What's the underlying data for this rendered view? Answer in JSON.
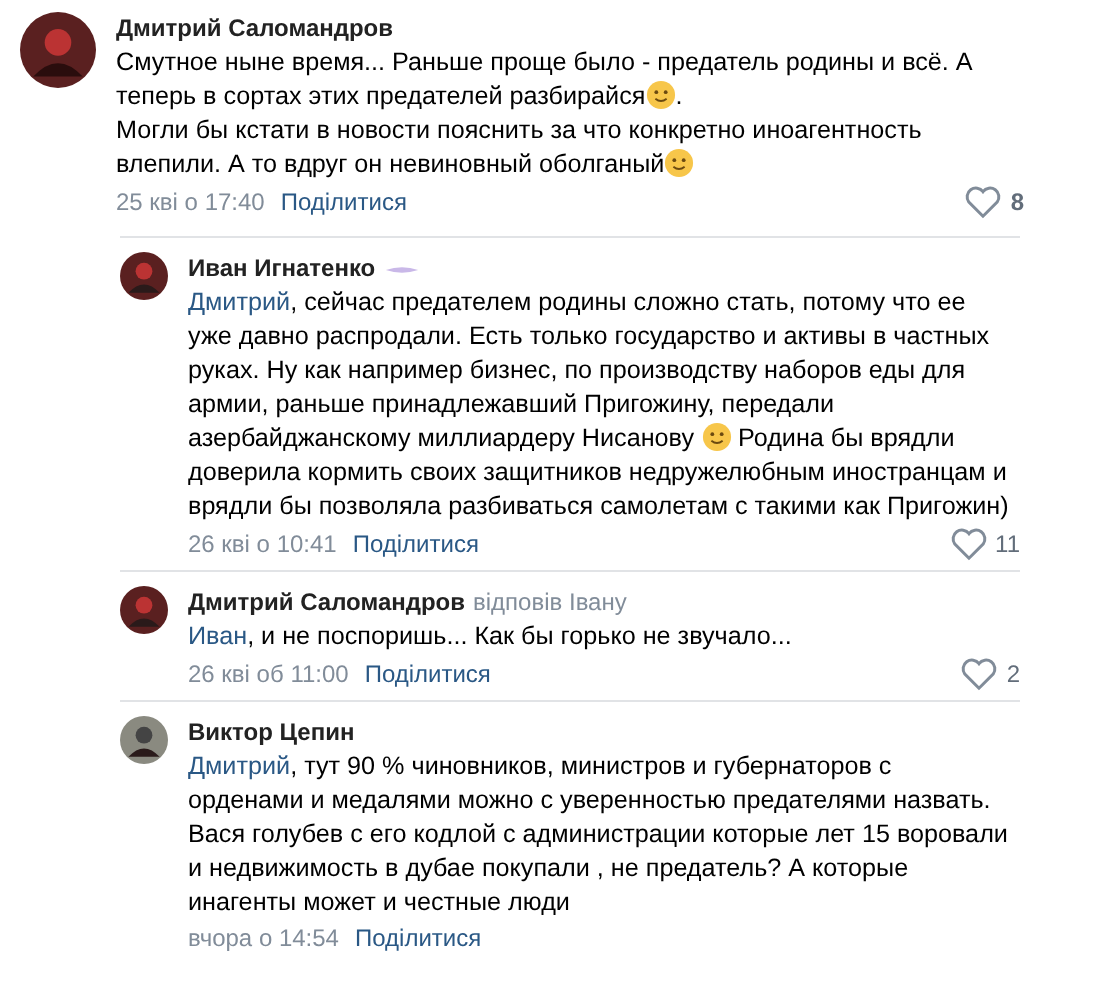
{
  "comments": [
    {
      "author": "Дмитрий Саломандров",
      "body": [
        {
          "kind": "text",
          "text": "Смутное ныне время... Раньше проще было - предатель родины и всё. А теперь в сортах этих предателей разбирайся"
        },
        {
          "kind": "emoji"
        },
        {
          "kind": "text",
          "text": ".\nМогли бы кстати в новости пояснить за что конкретно иноагентность влепили. А то вдруг он невиновный оболганый"
        },
        {
          "kind": "emoji"
        }
      ],
      "date": "25 кві о 17:40",
      "share": "Поділитися",
      "likes": "8",
      "liked_bold": true,
      "children": [
        {
          "author": "Иван Игнатенко",
          "badge": true,
          "body": [
            {
              "kind": "mention",
              "text": "Дмитрий"
            },
            {
              "kind": "text",
              "text": ", сейчас предателем родины сложно стать, потому что ее уже давно распродали. Есть только государство и активы в частных руках. Ну как например бизнес, по производству наборов еды для армии, раньше принадлежавший Пригожину, передали азербайджанскому миллиардеру Нисанову "
            },
            {
              "kind": "emoji"
            },
            {
              "kind": "text",
              "text": " Родина бы врядли доверила кормить своих защитников недружелюбным иностранцам и врядли бы позволяла разбиваться самолетам с такими как Пригожин)"
            }
          ],
          "date": "26 кві о 10:41",
          "share": "Поділитися",
          "likes": "11"
        },
        {
          "author": "Дмитрий Саломандров",
          "reply_to": "відповів Івану",
          "body": [
            {
              "kind": "mention",
              "text": "Иван"
            },
            {
              "kind": "text",
              "text": ", и не поспоришь... Как бы горько не звучало..."
            }
          ],
          "date": "26 кві об 11:00",
          "share": "Поділитися",
          "likes": "2"
        },
        {
          "author": "Виктор Цепин",
          "body": [
            {
              "kind": "mention",
              "text": "Дмитрий"
            },
            {
              "kind": "text",
              "text": ", тут 90 % чиновников, министров и губернаторов с орденами и медалями можно с уверенностью предателями назвать. Вася голубев с его кодлой с администрации которые лет 15 воровали и недвижимость в дубае покупали , не предатель? А которые инагенты может и честные люди"
            }
          ],
          "date": "вчора о 14:54",
          "share": "Поділитися"
        }
      ]
    }
  ]
}
